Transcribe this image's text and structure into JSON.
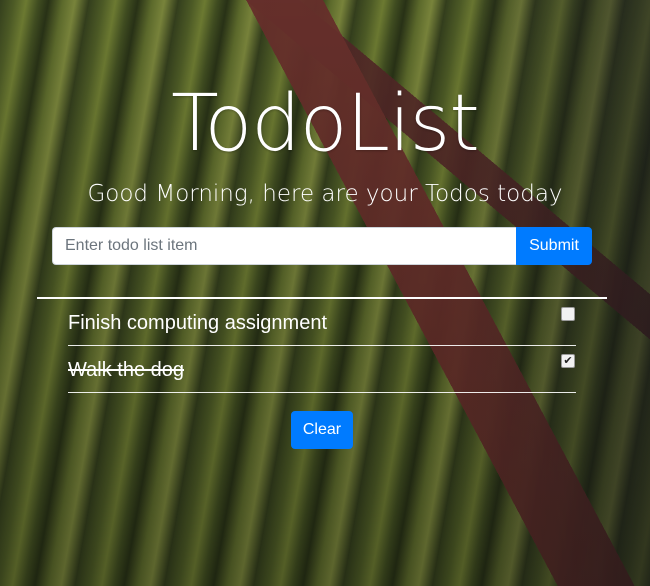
{
  "app": {
    "title": "TodoList",
    "greeting": "Good Morning, here are your Todos today"
  },
  "form": {
    "input_value": "",
    "input_placeholder": "Enter todo list item",
    "submit_label": "Submit"
  },
  "todos": [
    {
      "text": "Finish computing assignment",
      "completed": false
    },
    {
      "text": "Walk the dog",
      "completed": true
    }
  ],
  "actions": {
    "clear_label": "Clear"
  },
  "colors": {
    "primary": "#007bff",
    "text": "#ffffff",
    "input_background": "#ffffff"
  }
}
